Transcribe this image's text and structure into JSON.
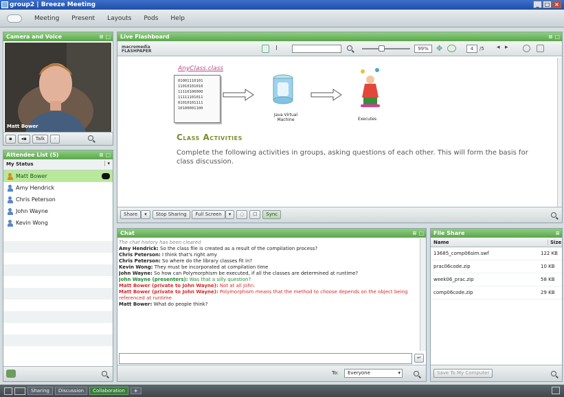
{
  "window": {
    "title": "group2 | Breeze Meeting"
  },
  "menu": [
    "Meeting",
    "Present",
    "Layouts",
    "Pods",
    "Help"
  ],
  "camera_pod": {
    "title": "Camera and Voice",
    "presenter_label": "Matt Bower",
    "talk_button": "Talk"
  },
  "attendee_pod": {
    "title": "Attendee List (5)",
    "status_label": "My Status",
    "attendees": [
      "Matt Bower",
      "Amy Hendrick",
      "Chris Peterson",
      "John Wayne",
      "Kevin Wong"
    ]
  },
  "share_pod": {
    "title": "Live Flashboard",
    "logo": "macromedia FLASHPAPER",
    "zoom": "99%",
    "page": "4",
    "page_total": "/5",
    "diagram": {
      "class_file": "AnyClass.class",
      "binary": "01001110101\n11010101010\n11110100000\n11111101011\n01010101111\n10100001100",
      "jvm_label": "Java Virtual Machine",
      "exec_label": "Executes"
    },
    "heading": "Class Activities",
    "body": "Complete the following activities in groups, asking questions of each other. This will form the basis for class discussion.",
    "buttons": {
      "share": "Share",
      "stop": "Stop Sharing",
      "fullscreen": "Full Screen",
      "sync": "Sync"
    }
  },
  "chat_pod": {
    "title": "Chat",
    "history_note": "The chat history has been cleared",
    "messages": [
      {
        "who": "Amy Hendrick:",
        "text": "So the class file is created as a result of the compilation process?",
        "color": "#222222"
      },
      {
        "who": "Chris Peterson:",
        "text": "I think that's right amy",
        "color": "#222222"
      },
      {
        "who": "Chris Peterson:",
        "text": "So where do the library classes fit in?",
        "color": "#222222"
      },
      {
        "who": "Kevin Wong:",
        "text": "They must be incorporated at compilation time",
        "color": "#222222"
      },
      {
        "who": "John Wayne:",
        "text": "So how can Polymorphism be executed, if all the classes are determined at runtime?",
        "color": "#222222"
      },
      {
        "who": "John Wayne (presenters):",
        "text": "Was that a silly question?",
        "color": "#1f8a2e"
      },
      {
        "who": "Matt Bower (private to John Wayne):",
        "text": "Not at all John.",
        "color": "#d22a2a"
      },
      {
        "who": "Matt Bower (private to John Wayne):",
        "text": "Polymorphism means that the method to choose depends on the object being referenced at runtime",
        "color": "#d22a2a"
      },
      {
        "who": "Matt Bower:",
        "text": "What do people think?",
        "color": "#222222"
      }
    ],
    "to_label": "To:",
    "to_value": "Everyone"
  },
  "file_pod": {
    "title": "File Share",
    "col_name": "Name",
    "col_size": "Size",
    "files": [
      {
        "name": "13685_comp06sim.swf",
        "size": "122 KB"
      },
      {
        "name": "prac06code.zip",
        "size": "10 KB"
      },
      {
        "name": "week06_prac.zip",
        "size": "58 KB"
      },
      {
        "name": "comp06code.zip",
        "size": "29 KB"
      }
    ],
    "save_button": "Save To My Computer"
  },
  "taskbar": {
    "tabs": [
      "Sharing",
      "Discussion",
      "Collaboration"
    ]
  },
  "colors": {
    "pod_header": "#6fb85f",
    "title_bar": "#2a5bb5",
    "host_highlight": "#b8e89a"
  }
}
